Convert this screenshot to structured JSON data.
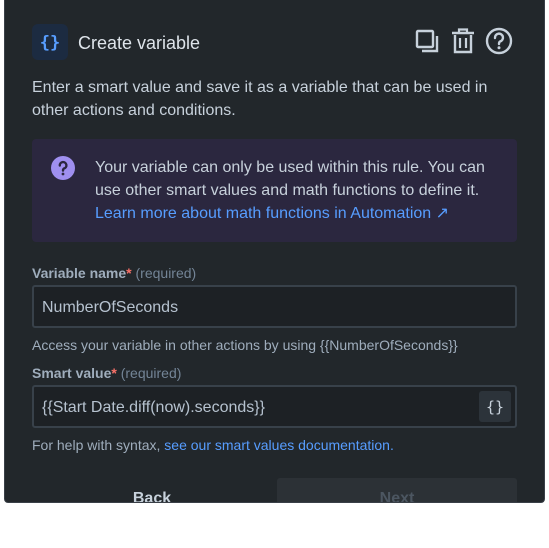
{
  "header": {
    "icon": "curly-braces-icon",
    "title": "Create variable",
    "tools": [
      "duplicate-icon",
      "trash-icon",
      "help-icon"
    ]
  },
  "description": "Enter a smart value and save it as a variable that can be used in other actions and conditions.",
  "info": {
    "icon": "question-icon",
    "text": "Your variable can only be used within this rule. You can use other smart values and math functions to define it.",
    "link": "Learn more about math functions in Automation ↗"
  },
  "variable_name": {
    "label": "Variable name",
    "required_star": "*",
    "required_text": "(required)",
    "value": "NumberOfSeconds",
    "helper": "Access your variable in other actions by using {{NumberOfSeconds}}"
  },
  "smart_value": {
    "label": "Smart value",
    "required_star": "*",
    "required_text": "(required)",
    "value": "{{Start Date.diff(now).seconds}}",
    "button": "{}",
    "helper_prefix": "For help with syntax, ",
    "helper_link": "see our smart values documentation."
  },
  "footer": {
    "back": "Back",
    "next": "Next"
  },
  "colors": {
    "panel": "#22272b",
    "info_bg": "#2b273f",
    "accent": "#579dff",
    "discovery": "#9f8fef",
    "required": "#f87168"
  }
}
